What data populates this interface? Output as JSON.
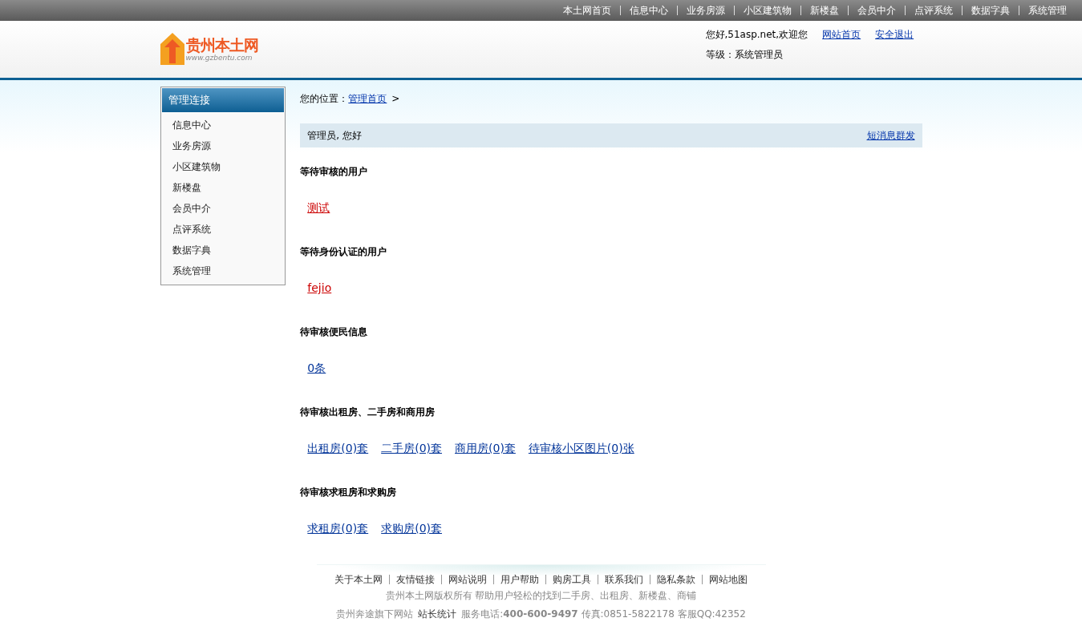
{
  "top_nav": [
    "本土网首页",
    "信息中心",
    "业务房源",
    "小区建筑物",
    "新楼盘",
    "会员中介",
    "点评系统",
    "数据字典",
    "系统管理"
  ],
  "logo": {
    "name": "贵州本土网",
    "url": "www.gzbentu.com"
  },
  "user_panel": {
    "greeting": "您好,51asp.net,欢迎您",
    "links": [
      "网站首页",
      "安全退出"
    ],
    "level": "等级：系统管理员"
  },
  "sidebar": {
    "title": "管理连接",
    "items": [
      "信息中心",
      "业务房源",
      "小区建筑物",
      "新楼盘",
      "会员中介",
      "点评系统",
      "数据字典",
      "系统管理"
    ]
  },
  "breadcrumb": {
    "label": "您的位置：",
    "link": "管理首页",
    "separator": ">"
  },
  "welcome_bar": {
    "text": "管理员, 您好",
    "action": "短消息群发"
  },
  "sections": [
    {
      "title": "等待审核的用户",
      "links": [
        {
          "text": "测试",
          "kind": "user"
        }
      ]
    },
    {
      "title": "等待身份认证的用户",
      "links": [
        {
          "text": "fejio",
          "kind": "user"
        }
      ]
    },
    {
      "title": "待审核便民信息",
      "links": [
        {
          "text": "0条",
          "kind": "count"
        }
      ]
    },
    {
      "title": "待审核出租房、二手房和商用房",
      "links": [
        {
          "text": "出租房(0)套",
          "kind": "count"
        },
        {
          "text": "二手房(0)套",
          "kind": "count"
        },
        {
          "text": "商用房(0)套",
          "kind": "count"
        },
        {
          "text": "待审核小区图片(0)张",
          "kind": "count"
        }
      ]
    },
    {
      "title": "待审核求租房和求购房",
      "links": [
        {
          "text": "求租房(0)套",
          "kind": "count"
        },
        {
          "text": "求购房(0)套",
          "kind": "count"
        }
      ]
    }
  ],
  "footer": {
    "links": [
      "关于本土网",
      "友情链接",
      "网站说明",
      "用户帮助",
      "购房工具",
      "联系我们",
      "隐私条款",
      "网站地图"
    ],
    "copyright": "贵州本土网版权所有  帮助用户轻松的找到二手房、出租房、新楼盘、商铺",
    "company": "贵州奔途旗下网站",
    "stats_link": "站长统计",
    "contact": "服务电话:**400-600-9497** 传真:0851-5822178 客服QQ:42352"
  }
}
